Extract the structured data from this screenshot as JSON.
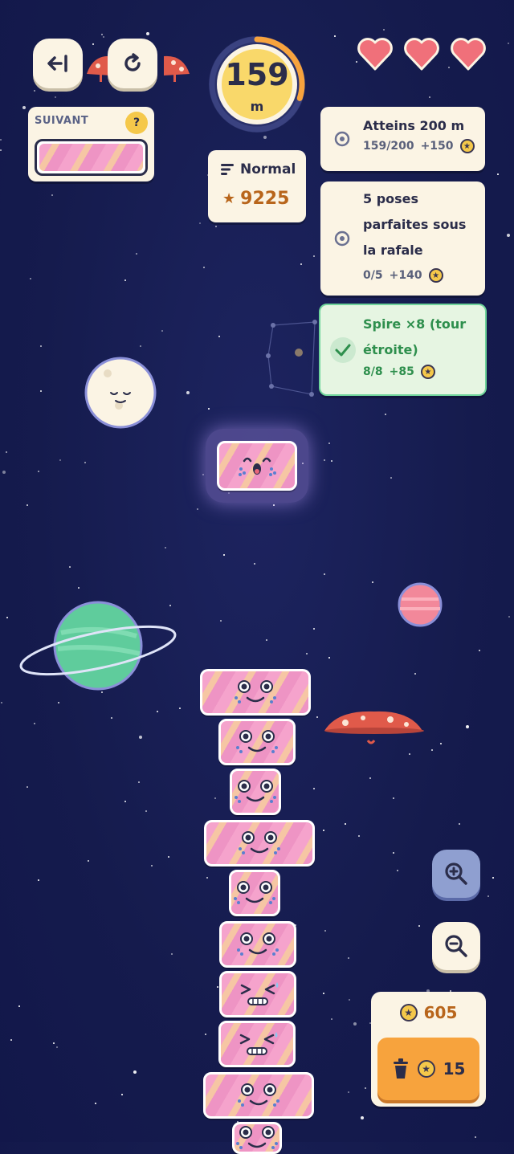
{
  "hud": {
    "altitude_value": "159",
    "altitude_unit": "m",
    "altitude_progress": 0.3,
    "difficulty_label": "Normal",
    "score": "9225",
    "lives": 3
  },
  "next_piece": {
    "label": "SUIVANT",
    "help": "?"
  },
  "missions": [
    {
      "title_lines": [
        "Atteins 200 m"
      ],
      "progress": "159/200",
      "reward": "+150",
      "completed": false
    },
    {
      "title_lines": [
        "5 poses",
        "parfaites sous",
        "la rafale"
      ],
      "progress": "0/5",
      "reward": "+140",
      "completed": false
    },
    {
      "title_lines": [
        "Spire ×8 (tour",
        "étroite)"
      ],
      "progress": "8/8",
      "reward": "+85",
      "completed": true
    }
  ],
  "shop": {
    "coins": "605",
    "delete_cost": "15"
  },
  "icons": {
    "back": "exit-icon",
    "restart": "restart-icon",
    "zoom_in": "zoom-in-icon",
    "zoom_out": "zoom-out-icon",
    "trash": "trash-icon"
  },
  "colors": {
    "background": "#151b4d",
    "panel": "#fbf4e4",
    "accent_orange": "#f7a33d",
    "success_green": "#2e8f4d",
    "heart": "#f0707a",
    "coin_gold": "#f5c84a"
  }
}
